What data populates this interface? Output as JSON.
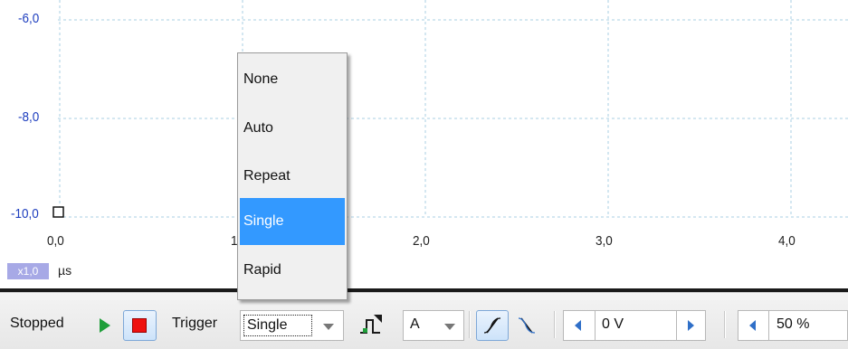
{
  "plot": {
    "y_ticks": [
      "-6,0",
      "-8,0",
      "-10,0"
    ],
    "x_ticks": [
      "0,0",
      "1",
      "2,0",
      "3,0",
      "4,0"
    ],
    "zoom_badge": "x1,0",
    "unit": "µs",
    "grid_color": "#a9cfe3",
    "tick_color": "#1f3fbf"
  },
  "toolbar": {
    "status": "Stopped",
    "trigger_label": "Trigger",
    "trigger_mode": "Single",
    "trigger_source": "A",
    "threshold_value": "0 V",
    "pretrigger_value": "50 %"
  },
  "trigger_menu": {
    "options": [
      "None",
      "Auto",
      "Repeat",
      "Single",
      "Rapid"
    ],
    "selected_index": 3,
    "highlight_color": "#3399ff"
  },
  "colors": {
    "run": "#1f9e3a",
    "stop": "#ee1111",
    "accent": "#2f6fc8"
  }
}
